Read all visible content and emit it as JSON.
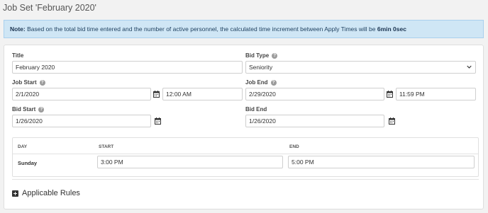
{
  "page": {
    "title": "Job Set 'February 2020'"
  },
  "note": {
    "label": "Note:",
    "text": " Based on the total bid time entered and the number of active personnel, the calculated time increment between Apply Times will be ",
    "increment": "6min 0sec"
  },
  "form": {
    "title": {
      "label": "Title",
      "value": "February 2020"
    },
    "bid_type": {
      "label": "Bid Type",
      "value": "Seniority",
      "options": [
        "Seniority"
      ]
    },
    "job_start": {
      "label": "Job Start",
      "date": "2/1/2020",
      "time": "12:00 AM"
    },
    "job_end": {
      "label": "Job End",
      "date": "2/29/2020",
      "time": "11:59 PM"
    },
    "bid_start": {
      "label": "Bid Start",
      "date": "1/26/2020"
    },
    "bid_end": {
      "label": "Bid End",
      "date": "1/26/2020"
    }
  },
  "schedule": {
    "headers": {
      "day": "DAY",
      "start": "START",
      "end": "END"
    },
    "rows": [
      {
        "day": "Sunday",
        "start": "3:00 PM",
        "end": "5:00 PM"
      }
    ]
  },
  "rules": {
    "label": "Applicable Rules"
  },
  "icons": {
    "help": "question-circle-icon",
    "calendar": "calendar-icon",
    "select": "chevron-down-icon",
    "expand": "plus-square-icon"
  }
}
